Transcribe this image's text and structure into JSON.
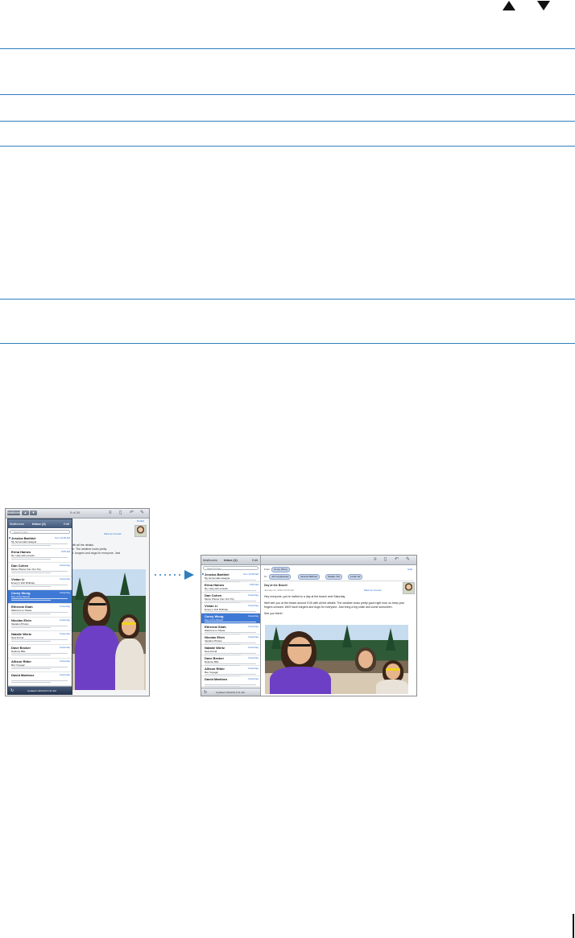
{
  "nav": {
    "prev_icon": "triangle-up-icon",
    "next_icon": "triangle-down-icon"
  },
  "colors": {
    "rule": "#2f7fbf",
    "selected_row": "#3f79d6"
  },
  "figure": {
    "left_screen": {
      "toolbar": {
        "mailboxes_button": "Mailboxes",
        "counter": "5 of 30"
      },
      "list": {
        "back": "Mailboxes",
        "title": "Inbox (1)",
        "edit": "Edit",
        "search_placeholder": "Search Inbox",
        "footer": "Updated 10/24/10 6:31 AM"
      },
      "message": {
        "details_link": "Details",
        "mark_unread": "Mark as Unread"
      },
      "partial_text": [
        "vith all the details.",
        "re. The weather looks pretty",
        "rt, burgers and dogs for everyone. Jeal"
      ]
    },
    "right_screen": {
      "list": {
        "back": "Mailboxes",
        "title": "Inbox (1)",
        "edit": "Edit",
        "search_placeholder": "Search Inbox",
        "footer": "Updated 10/24/10 6:31 AM"
      },
      "message": {
        "from_label": "From:",
        "from": "Corey Wong",
        "to_label": "To:",
        "to": [
          "John Appleseed",
          "Jessica Barthiel",
          "Natalie Tort",
          "Leslie Gil"
        ],
        "hide_link": "Hide",
        "subject": "Day at the Beach!",
        "date": "January 24, 2010 10:00 AM",
        "mark_unread": "Mark as Unread",
        "body": [
          "Hey everyone, you're invited to a day at the beach next Saturday.",
          "Well see you at the beach around 9:00 with all the details. The weather looks pretty good right now, so keep your fingers crossed. We'll have burgers and dogs for everyone. Just bring a big smile and some sunscreen.",
          "See you there!"
        ]
      }
    },
    "messages": [
      {
        "sender": "Jessica Barthiel",
        "time": "Sun  10:48 AM",
        "subject": "My homemade lasagna",
        "selected": false,
        "unread": true
      },
      {
        "sender": "Erina Haines",
        "time": "9:55 AM",
        "subject": "Re: Help with errands",
        "selected": false,
        "unread": false
      },
      {
        "sender": "Dan Cohen",
        "time": "Yesterday",
        "subject": "Movie Photos from Our Trip",
        "selected": false,
        "unread": false
      },
      {
        "sender": "Vivian Li",
        "time": "Yesterday",
        "subject": "Emery's 11th Birthday",
        "selected": false,
        "unread": false
      },
      {
        "sender": "Corey Wong",
        "time": "Yesterday",
        "subject": "Day at the Beach",
        "selected": true,
        "unread": false
      },
      {
        "sender": "Ethereal Shah",
        "time": "Yesterday",
        "subject": "Welcome to Oiteas",
        "selected": false,
        "unread": false
      },
      {
        "sender": "Nicolas Elvin",
        "time": "Yesterday",
        "subject": "Vacation Photos",
        "selected": false,
        "unread": false
      },
      {
        "sender": "Natalie Wertz",
        "time": "Yesterday",
        "subject": "New Arrival",
        "selected": false,
        "unread": false
      },
      {
        "sender": "Dave Becker",
        "time": "Yesterday",
        "subject": "Defense Bills",
        "selected": false,
        "unread": false
      },
      {
        "sender": "Allison Ritter",
        "time": "Yesterday",
        "subject": "Bon Voyage!",
        "selected": false,
        "unread": false
      },
      {
        "sender": "David Martinez",
        "time": "Yesterday",
        "subject": "",
        "selected": false,
        "unread": false
      }
    ]
  }
}
